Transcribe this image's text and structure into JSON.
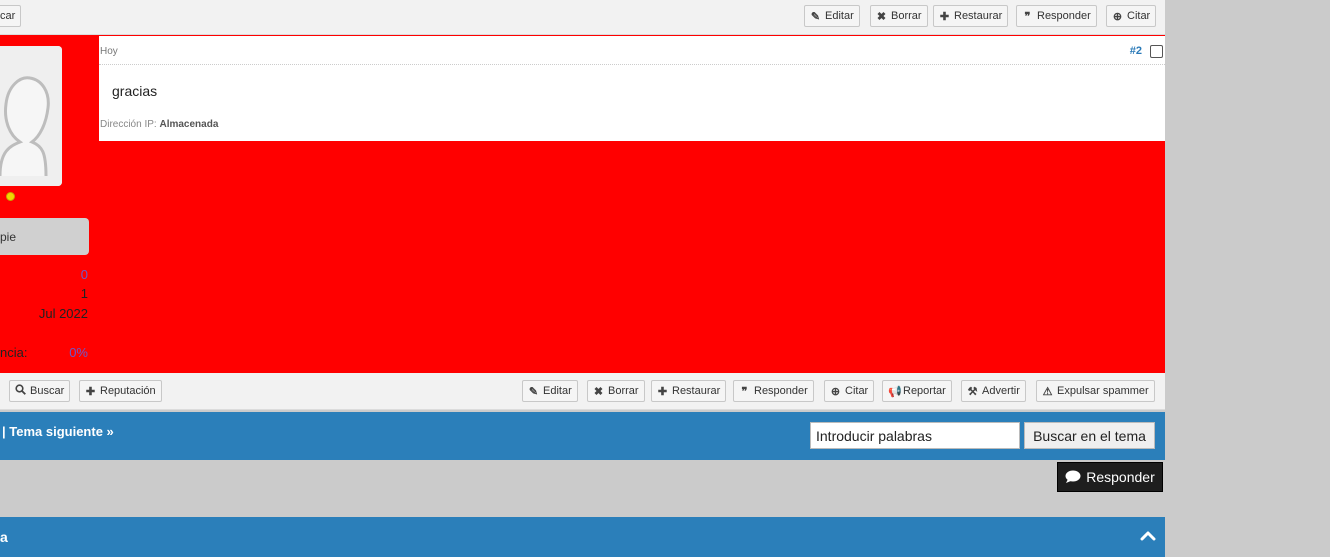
{
  "top_toolbar": {
    "left_partial": "car",
    "edit": "Editar",
    "delete": "Borrar",
    "restore": "Restaurar",
    "reply": "Responder",
    "quote": "Citar"
  },
  "post": {
    "date": "Hoy",
    "number": "#2",
    "message": "gracias",
    "ip_label": "Dirección IP:",
    "ip_value": "Almacenada"
  },
  "user": {
    "rank_partial": "pie",
    "stats": [
      "0",
      "1",
      "Jul 2022",
      "0%"
    ],
    "stat_label_partial": "ncia:"
  },
  "bottom_toolbar": {
    "search": "Buscar",
    "reputation": "Reputación",
    "edit": "Editar",
    "delete": "Borrar",
    "restore": "Restaurar",
    "reply": "Responder",
    "quote": "Citar",
    "report": "Reportar",
    "warn": "Advertir",
    "ban_spammer": "Expulsar spammer"
  },
  "nav": {
    "text": "| Tema siguiente »",
    "search_value": "Introducir palabras",
    "search_button": "Buscar en el tema"
  },
  "reply_button": "Responder",
  "footer": {
    "text_partial": "a"
  },
  "colors": {
    "accent_blue": "#2b7fba",
    "post_background": "#ff0000"
  }
}
